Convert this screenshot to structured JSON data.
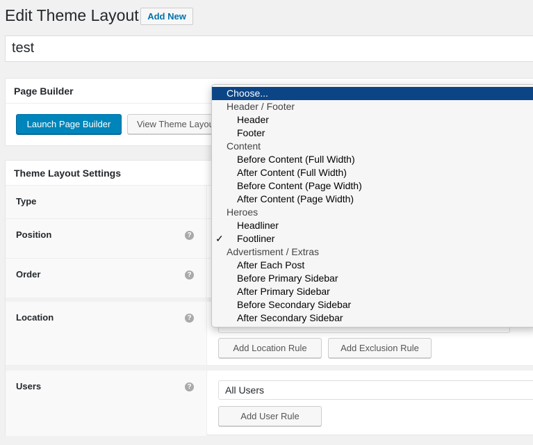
{
  "header": {
    "title": "Edit Theme Layout",
    "add_new": "Add New"
  },
  "post_title": "test",
  "page_builder": {
    "title": "Page Builder",
    "launch": "Launch Page Builder",
    "view": "View Theme Layout"
  },
  "settings": {
    "title": "Theme Layout Settings",
    "type_label": "Type",
    "position_label": "Position",
    "order_label": "Order",
    "location_label": "Location",
    "users_label": "Users",
    "add_location_rule": "Add Location Rule",
    "add_exclusion_rule": "Add Exclusion Rule",
    "users_value": "All Users",
    "add_user_rule": "Add User Rule",
    "help": "?"
  },
  "dropdown": {
    "checkmark": "✓",
    "options": [
      {
        "label": "Choose...",
        "kind": "option",
        "highlighted": true
      },
      {
        "label": "Header / Footer",
        "kind": "group"
      },
      {
        "label": "Header",
        "kind": "option"
      },
      {
        "label": "Footer",
        "kind": "option"
      },
      {
        "label": "Content",
        "kind": "group"
      },
      {
        "label": "Before Content (Full Width)",
        "kind": "option"
      },
      {
        "label": "After Content (Full Width)",
        "kind": "option"
      },
      {
        "label": "Before Content (Page Width)",
        "kind": "option"
      },
      {
        "label": "After Content (Page Width)",
        "kind": "option"
      },
      {
        "label": "Heroes",
        "kind": "group"
      },
      {
        "label": "Headliner",
        "kind": "option"
      },
      {
        "label": "Footliner",
        "kind": "option",
        "checked": true
      },
      {
        "label": "Advertisment / Extras",
        "kind": "group"
      },
      {
        "label": "After Each Post",
        "kind": "option"
      },
      {
        "label": "Before Primary Sidebar",
        "kind": "option"
      },
      {
        "label": "After Primary Sidebar",
        "kind": "option"
      },
      {
        "label": "Before Secondary Sidebar",
        "kind": "option"
      },
      {
        "label": "After Secondary Sidebar",
        "kind": "option"
      }
    ]
  },
  "colors": {
    "primary": "#0085ba",
    "highlight": "#0c4586"
  }
}
